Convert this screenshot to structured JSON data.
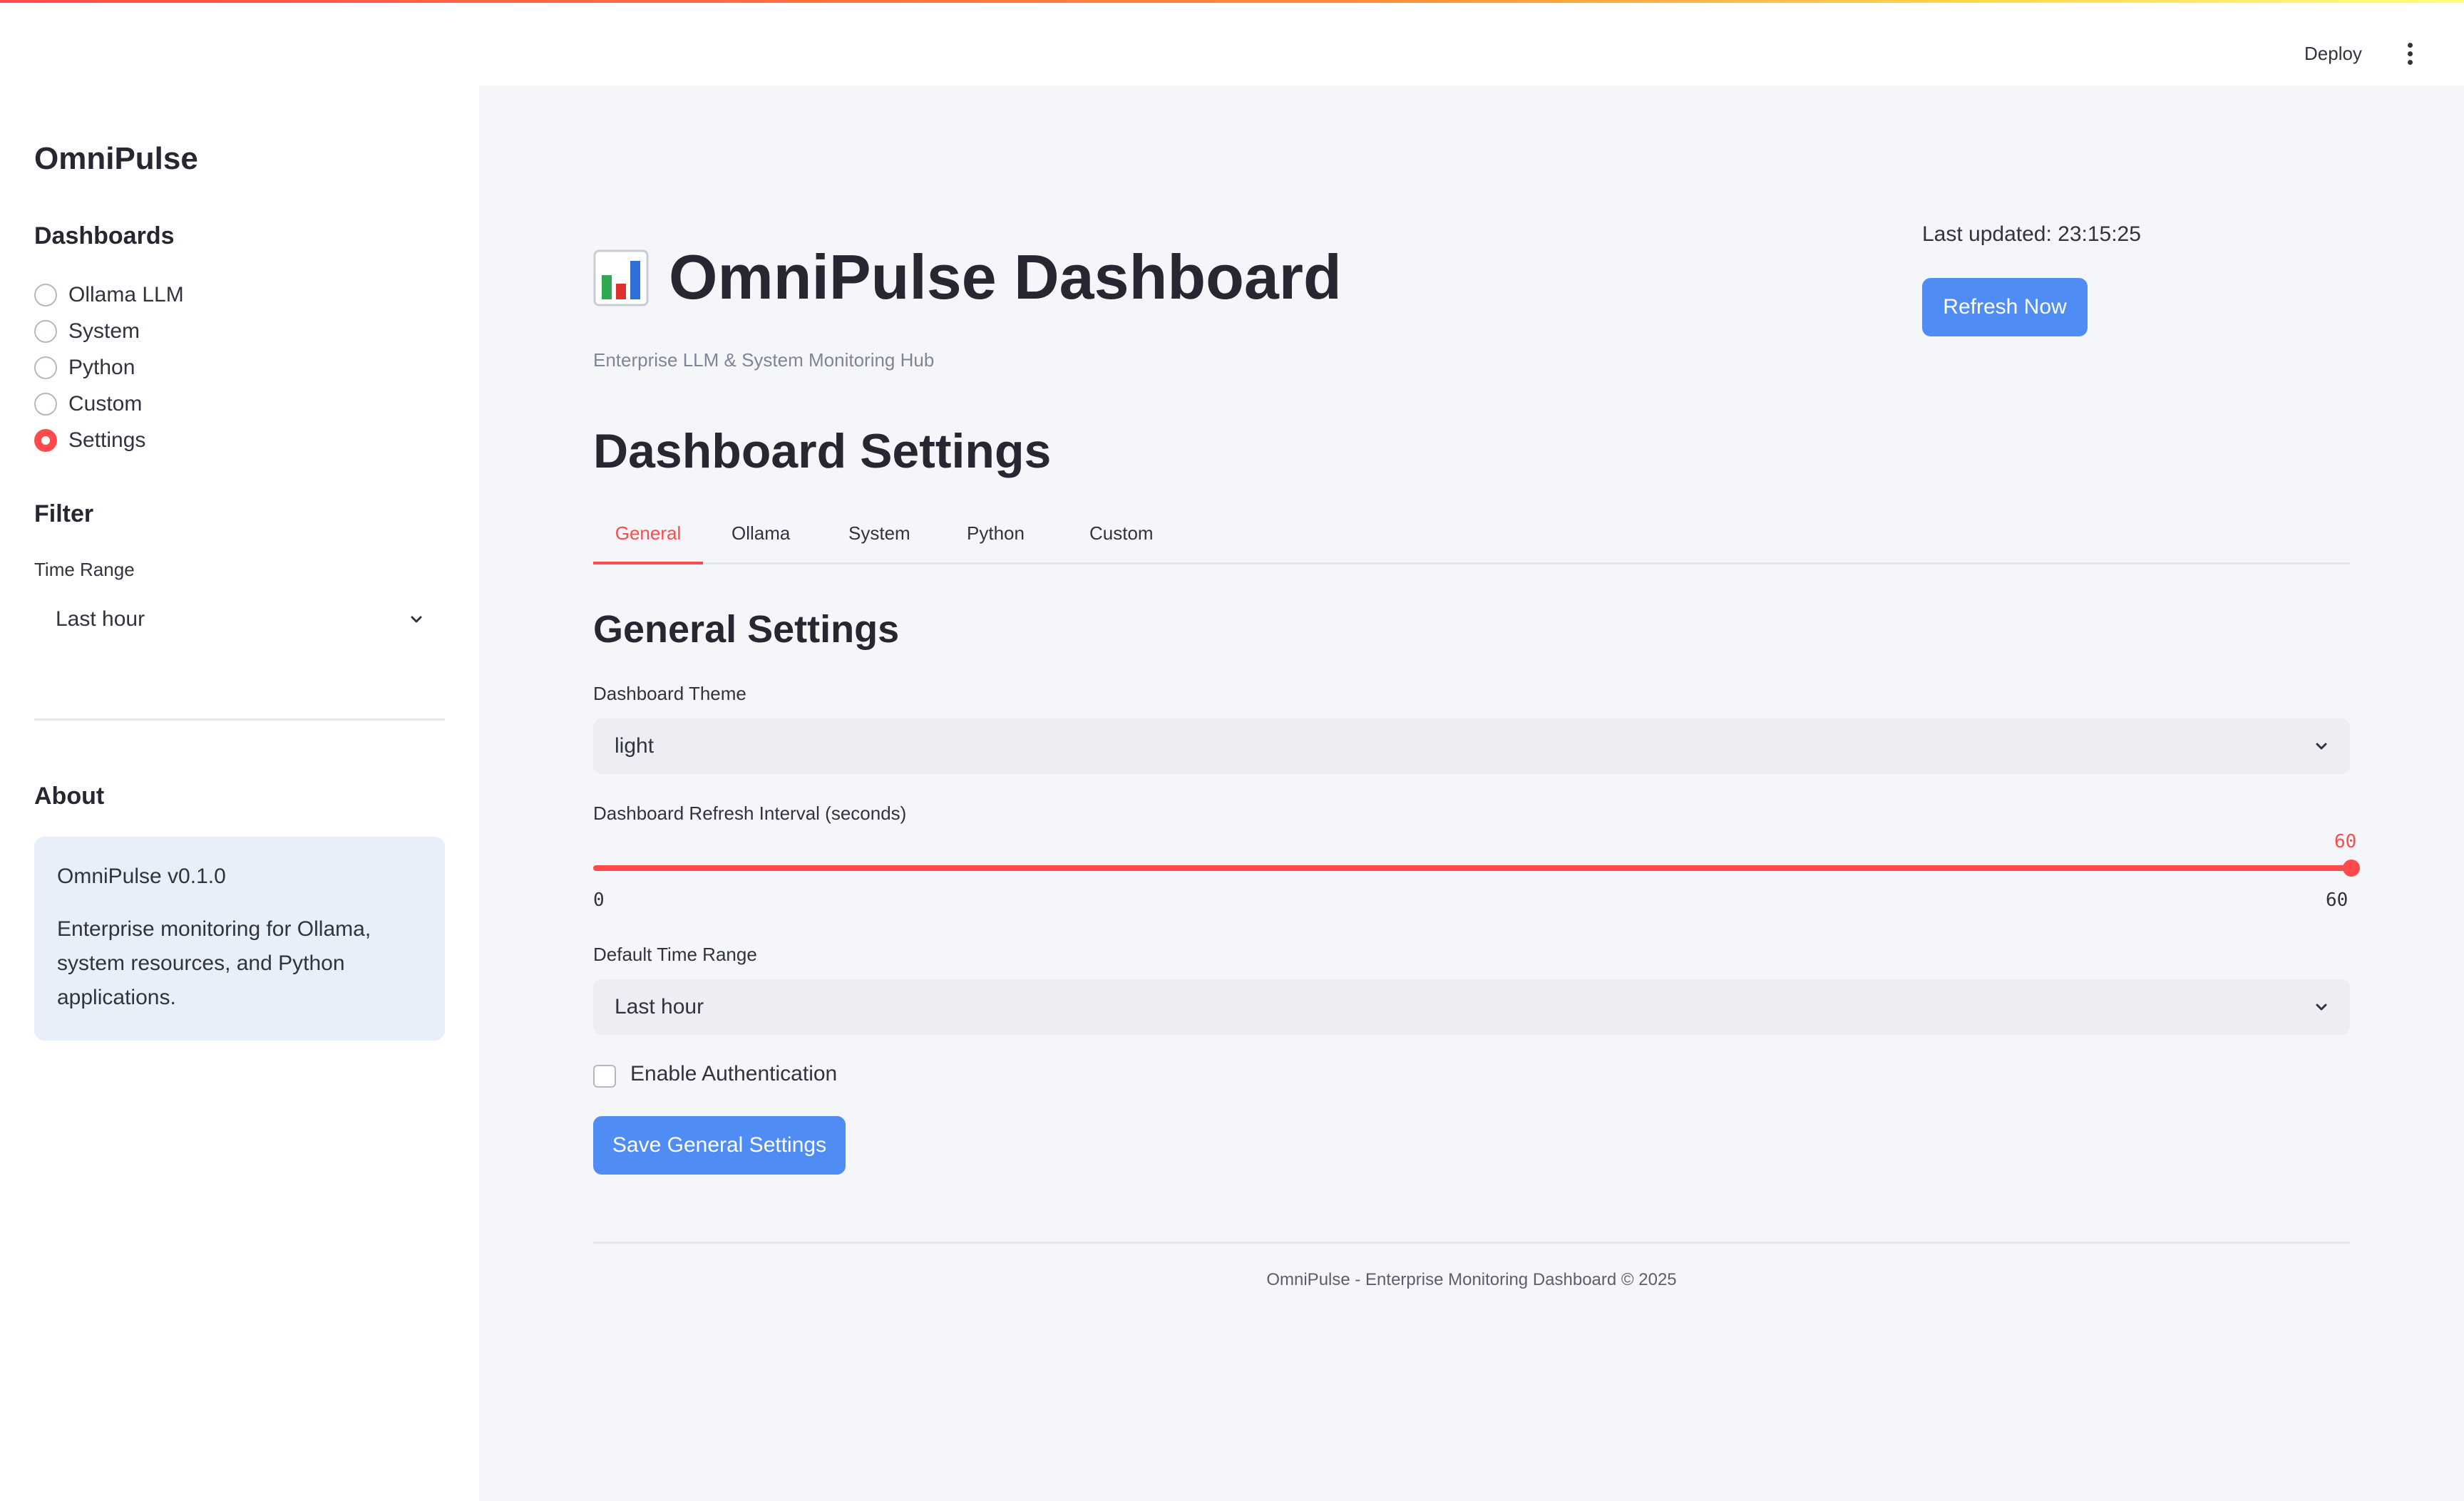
{
  "header": {
    "deploy_label": "Deploy"
  },
  "sidebar": {
    "title": "OmniPulse",
    "dashboards_heading": "Dashboards",
    "dashboards": [
      {
        "label": "Ollama LLM",
        "selected": false
      },
      {
        "label": "System",
        "selected": false
      },
      {
        "label": "Python",
        "selected": false
      },
      {
        "label": "Custom",
        "selected": false
      },
      {
        "label": "Settings",
        "selected": true
      }
    ],
    "filter_heading": "Filter",
    "time_range_label": "Time Range",
    "time_range_value": "Last hour",
    "about_heading": "About",
    "about_version": "OmniPulse v0.1.0",
    "about_text": "Enterprise monitoring for Ollama, system resources, and Python applications."
  },
  "main": {
    "title": "OmniPulse Dashboard",
    "subtitle": "Enterprise LLM & System Monitoring Hub",
    "last_updated": "Last updated: 23:15:25",
    "refresh_label": "Refresh Now",
    "section_title": "Dashboard Settings",
    "tabs": [
      {
        "label": "General",
        "active": true
      },
      {
        "label": "Ollama",
        "active": false
      },
      {
        "label": "System",
        "active": false
      },
      {
        "label": "Python",
        "active": false
      },
      {
        "label": "Custom",
        "active": false
      }
    ],
    "general_title": "General Settings",
    "theme_label": "Dashboard Theme",
    "theme_value": "light",
    "refresh_interval_label": "Dashboard Refresh Interval (seconds)",
    "refresh_interval_value": "60",
    "refresh_interval_min": "0",
    "refresh_interval_max": "60",
    "default_range_label": "Default Time Range",
    "default_range_value": "Last hour",
    "auth_label": "Enable Authentication",
    "auth_checked": false,
    "save_label": "Save General Settings",
    "footer": "OmniPulse - Enterprise Monitoring Dashboard © 2025"
  },
  "colors": {
    "accent": "#ff4b4b",
    "primary_button": "#4f8cf3",
    "main_background": "#f5f6fa",
    "about_background": "#e7effb"
  },
  "icons": {
    "title_icon": "bar-chart-emoji",
    "menu_icon": "vertical-ellipsis-icon",
    "select_icon": "chevron-down-icon"
  }
}
